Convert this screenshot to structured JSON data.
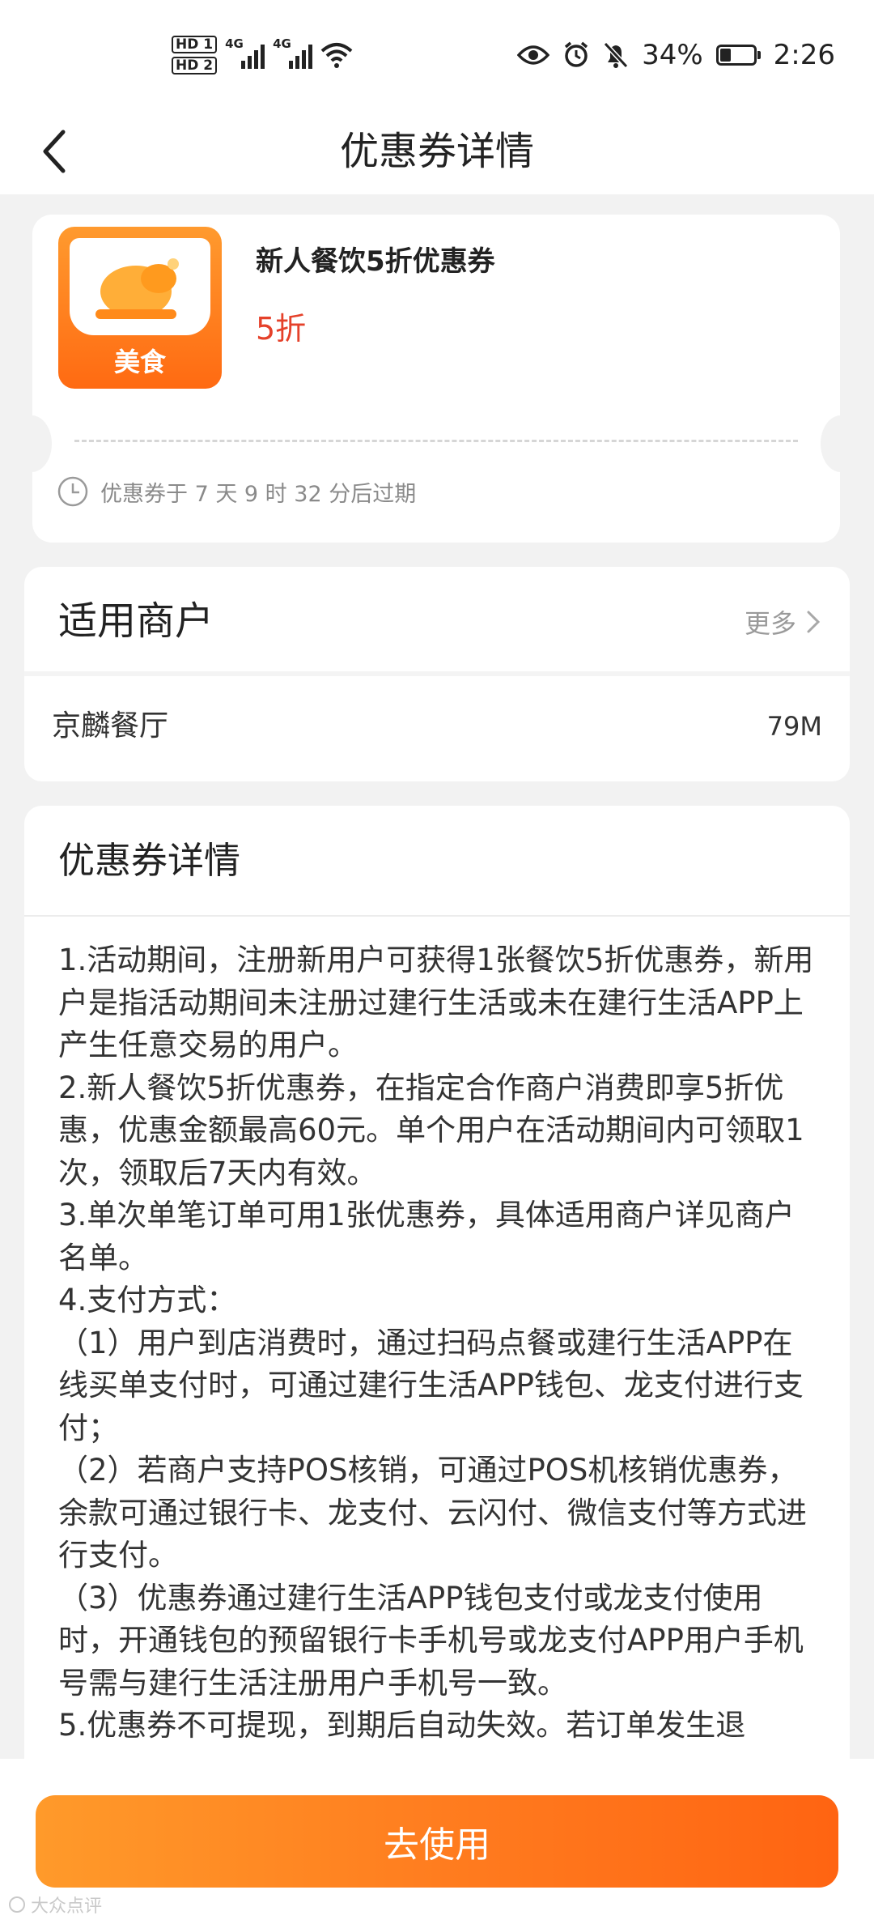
{
  "status_bar": {
    "hd1": "HD 1",
    "hd2": "HD 2",
    "net1": "4G",
    "net2": "4G",
    "battery": "34%",
    "battery_level": 0.34,
    "time": "2:26"
  },
  "nav": {
    "title": "优惠券详情"
  },
  "coupon": {
    "category": "美食",
    "name": "新人餐饮5折优惠券",
    "value": "5折",
    "expire_text": "优惠券于 7 天 9 时 32 分后过期"
  },
  "merchants": {
    "title": "适用商户",
    "more_label": "更多",
    "items": [
      {
        "name": "京麟餐厅",
        "distance": "79M"
      }
    ]
  },
  "details": {
    "title": "优惠券详情",
    "paragraphs": [
      "1.活动期间，注册新用户可获得1张餐饮5折优惠券，新用户是指活动期间未注册过建行生活或未在建行生活APP上产生任意交易的用户。",
      "2.新人餐饮5折优惠券，在指定合作商户消费即享5折优惠，优惠金额最高60元。单个用户在活动期间内可领取1次，领取后7天内有效。",
      "3.单次单笔订单可用1张优惠券，具体适用商户详见商户名单。",
      "4.支付方式：",
      "（1）用户到店消费时，通过扫码点餐或建行生活APP在线买单支付时，可通过建行生活APP钱包、龙支付进行支付；",
      "（2）若商户支持POS核销，可通过POS机核销优惠券，余款可通过银行卡、龙支付、云闪付、微信支付等方式进行支付。",
      "（3）优惠券通过建行生活APP钱包支付或龙支付使用时，开通钱包的预留银行卡手机号或龙支付APP用户手机号需与建行生活注册用户手机号一致。",
      "5.优惠券不可提现，到期后自动失效。若订单发生退"
    ]
  },
  "bottom": {
    "use_label": "去使用"
  },
  "watermark": {
    "text": "大众点评"
  },
  "colors": {
    "accent_orange": "#ff7a1e",
    "price_red": "#e5412a",
    "page_bg": "#f2f2f2"
  },
  "icons": [
    "back-chevron-icon",
    "eye-icon",
    "alarm-icon",
    "bell-off-icon",
    "wifi-icon",
    "signal-icon",
    "battery-icon",
    "clock-icon",
    "chevron-right-icon",
    "roast-chicken-icon"
  ]
}
